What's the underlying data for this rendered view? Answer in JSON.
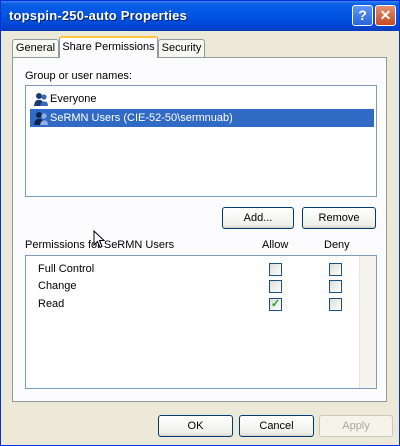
{
  "window": {
    "title": "topspin-250-auto Properties",
    "help_glyph": "?",
    "close_glyph": "✕"
  },
  "tabs": [
    {
      "label": "General"
    },
    {
      "label": "Share Permissions"
    },
    {
      "label": "Security"
    }
  ],
  "groups": {
    "label": "Group or user names:",
    "items": [
      {
        "name": "Everyone"
      },
      {
        "name": "SeRMN Users (CIE-52-50\\sermnuab)"
      }
    ],
    "add_button": "Add...",
    "remove_button": "Remove"
  },
  "permissions": {
    "label": "Permissions for SeRMN Users",
    "allow_header": "Allow",
    "deny_header": "Deny",
    "rows": [
      {
        "name": "Full Control",
        "allow": false,
        "deny": false
      },
      {
        "name": "Change",
        "allow": false,
        "deny": false
      },
      {
        "name": "Read",
        "allow": true,
        "deny": false
      }
    ],
    "check_glyph": "✓"
  },
  "footer": {
    "ok": "OK",
    "cancel": "Cancel",
    "apply": "Apply"
  },
  "colors": {
    "titlebar": "#0055e5",
    "selection": "#316ac5",
    "dialog_bg": "#ece9d8",
    "check": "#21a121"
  }
}
